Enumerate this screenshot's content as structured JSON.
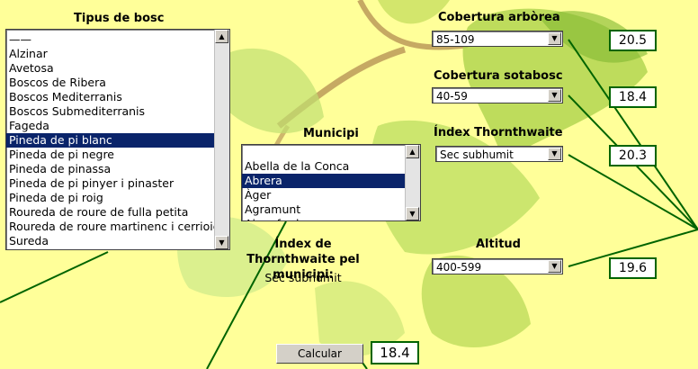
{
  "tipus_bosc": {
    "label": "Tipus de bosc",
    "items": [
      "——",
      "Alzinar",
      "Avetosa",
      "Boscos de Ribera",
      "Boscos Mediterranis",
      "Boscos Submediterranis",
      "Fageda",
      "Pineda de pi blanc",
      "Pineda de pi negre",
      "Pineda de pinassa",
      "Pineda de pi pinyer i pinaster",
      "Pineda de pi roig",
      "Roureda de roure de fulla petita",
      "Roureda de roure martinenc i cerrioide",
      "Sureda"
    ],
    "selected_index": 7
  },
  "municipi": {
    "label": "Municipi",
    "items": [
      "Abella de la Conca",
      "Abrera",
      "Àger",
      "Agramunt",
      "Aiguafreda"
    ],
    "selected_index": 1
  },
  "index_municipi": {
    "label": "Índex de Thornthwaite pel municipi:",
    "value": "Sec subhumit"
  },
  "cobertura_arborea": {
    "label": "Cobertura arbòrea",
    "value": "85-109",
    "result": "20.5"
  },
  "cobertura_sotabosc": {
    "label": "Cobertura sotabosc",
    "value": "40-59",
    "result": "18.4"
  },
  "index_thornthwaite": {
    "label": "Índex Thornthwaite",
    "value": "Sec subhumit",
    "result": "20.3"
  },
  "altitud": {
    "label": "Altitud",
    "value": "400-599",
    "result": "19.6"
  },
  "calcular": {
    "label": "Calcular",
    "result": "18.4"
  },
  "colors": {
    "background": "#ffff99",
    "line": "#006400",
    "selection": "#0a246a"
  }
}
